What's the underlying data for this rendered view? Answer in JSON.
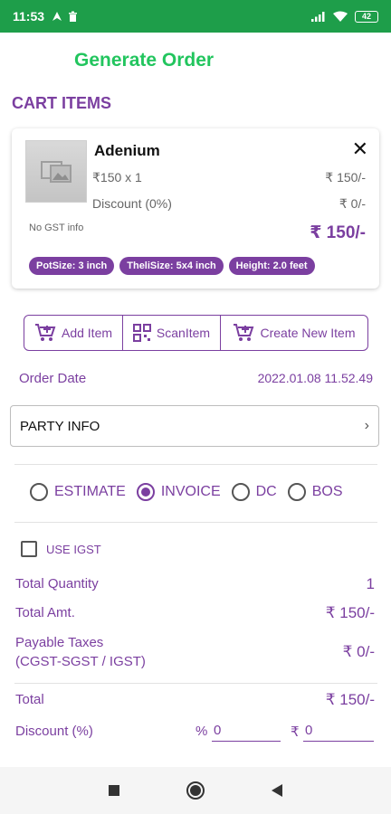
{
  "status_bar": {
    "time": "11:53",
    "battery": "42"
  },
  "app_title": "Generate Order",
  "section_title": "CART ITEMS",
  "cart_item": {
    "name": "Adenium",
    "price_qty": "₹150  x 1",
    "price_total_right": "₹ 150/-",
    "discount_label": "Discount (0%)",
    "discount_value": "₹ 0/-",
    "gst_info": "No GST info",
    "total": "₹ 150/-",
    "chips": [
      "PotSize: 3 inch",
      "TheliSize: 5x4 inch",
      "Height: 2.0 feet"
    ]
  },
  "actions": {
    "add_item": "Add Item",
    "scan_item": "ScanItem",
    "create_new_item": "Create New Item"
  },
  "order_date": {
    "label": "Order Date",
    "value": "2022.01.08 11.52.49"
  },
  "party_info": {
    "label": "PARTY INFO"
  },
  "doc_types": [
    {
      "label": "ESTIMATE",
      "selected": false
    },
    {
      "label": "INVOICE",
      "selected": true
    },
    {
      "label": "DC",
      "selected": false
    },
    {
      "label": "BOS",
      "selected": false
    }
  ],
  "use_igst": {
    "label": "USE IGST",
    "checked": false
  },
  "summary": {
    "total_quantity_label": "Total Quantity",
    "total_quantity_value": "1",
    "total_amt_label": "Total Amt.",
    "total_amt_value": "₹ 150/-",
    "payable_taxes_label_1": "Payable Taxes",
    "payable_taxes_label_2": "(CGST-SGST / IGST)",
    "payable_taxes_value": "₹ 0/-",
    "total_label": "Total",
    "total_value": "₹ 150/-",
    "discount_label": "Discount (%)",
    "discount_pct_sign": "%",
    "discount_pct_value": "0",
    "discount_rupee_sign": "₹",
    "discount_amt_value": "0"
  },
  "colors": {
    "status_bar": "#1e9e4a",
    "title_green": "#22c55e",
    "accent_purple": "#7b3fa0"
  }
}
